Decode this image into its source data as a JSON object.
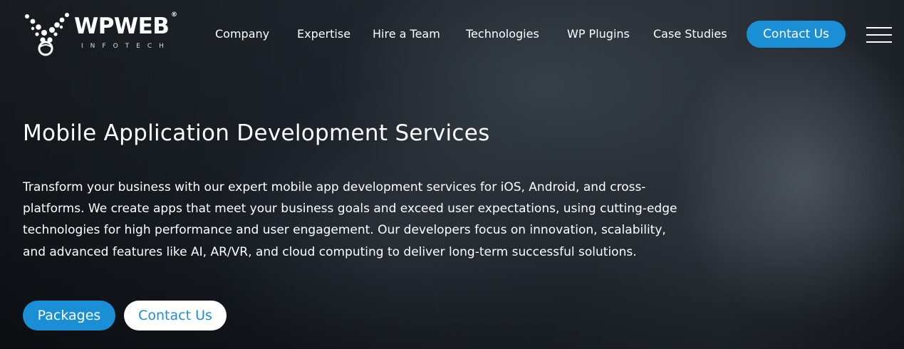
{
  "brand": {
    "name": "WPWEB",
    "registered": "®",
    "tagline": "INFOTECH"
  },
  "nav": {
    "items": [
      {
        "label": "Company"
      },
      {
        "label": "Expertise"
      },
      {
        "label": "Hire a Team"
      },
      {
        "label": "Technologies"
      },
      {
        "label": "WP Plugins"
      },
      {
        "label": "Case Studies"
      }
    ],
    "contact_label": "Contact Us",
    "menu_icon": "hamburger-menu-icon"
  },
  "hero": {
    "title": "Mobile Application Development Services",
    "description": "Transform your business with our expert mobile app development services for iOS, Android, and cross-platforms. We create apps that meet your business goals and exceed user expectations, using cutting-edge technologies for high performance and user engagement. Our developers focus on innovation, scalability, and advanced features like AI, AR/VR, and cloud computing to deliver long-term successful solutions.",
    "primary_button": "Packages",
    "secondary_button": "Contact Us"
  },
  "colors": {
    "accent": "#1a8fd6",
    "text": "#ffffff",
    "background": "#1a2027"
  }
}
